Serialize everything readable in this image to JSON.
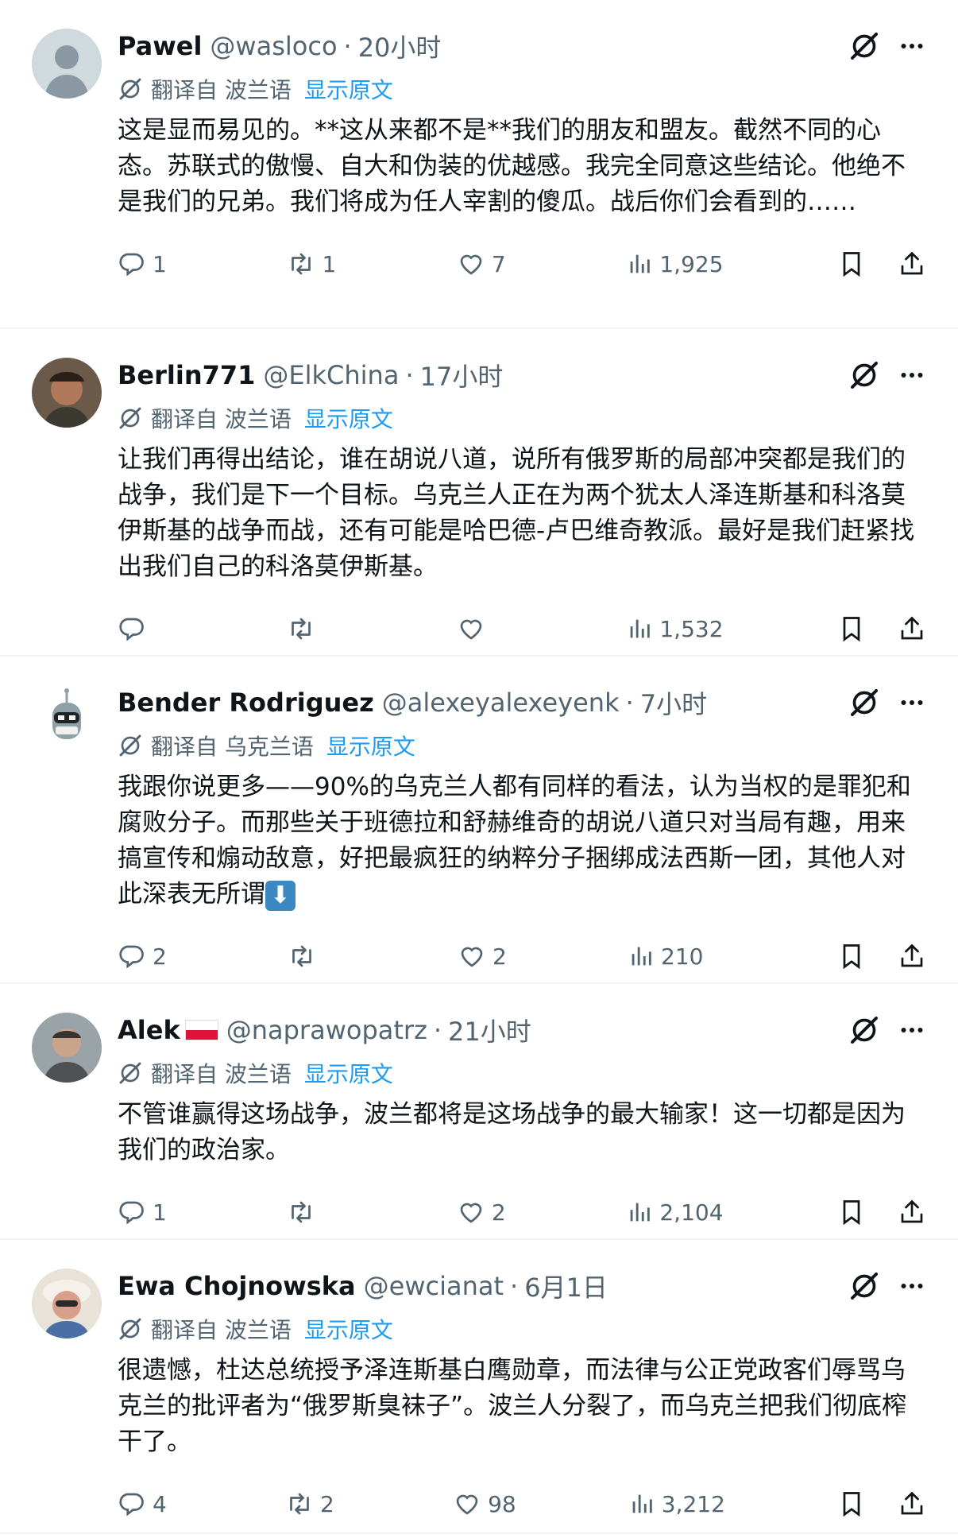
{
  "posts": [
    {
      "name": "Pawel",
      "handle": "@wasloco",
      "time": "20小时",
      "translate_label": "翻译自 波兰语",
      "show_original": "显示原文",
      "text": "这是显而易见的。**这从来都不是**我们的朋友和盟友。截然不同的心态。苏联式的傲慢、自大和伪装的优越感。我完全同意这些结论。他绝不是我们的兄弟。我们将成为任人宰割的傻瓜。战后你们会看到的……",
      "replies": "1",
      "reposts": "1",
      "likes": "7",
      "views": "1,925"
    },
    {
      "name": "Berlin771",
      "handle": "@ElkChina",
      "time": "17小时",
      "translate_label": "翻译自 波兰语",
      "show_original": "显示原文",
      "text": "让我们再得出结论，谁在胡说八道，说所有俄罗斯的局部冲突都是我们的战争，我们是下一个目标。乌克兰人正在为两个犹太人泽连斯基和科洛莫伊斯基的战争而战，还有可能是哈巴德-卢巴维奇教派。最好是我们赶紧找出我们自己的科洛莫伊斯基。",
      "replies": "",
      "reposts": "",
      "likes": "",
      "views": "1,532"
    },
    {
      "name": "Bender Rodriguez",
      "handle": "@alexeyalexeyenk",
      "time": "7小时",
      "translate_label": "翻译自 乌克兰语",
      "show_original": "显示原文",
      "text": "我跟你说更多——90%的乌克兰人都有同样的看法，认为当权的是罪犯和腐败分子。而那些关于班德拉和舒赫维奇的胡说八道只对当局有趣，用来搞宣传和煽动敌意，好把最疯狂的纳粹分子捆绑成法西斯一团，其他人对此深表无所谓",
      "emoji": "⬇",
      "replies": "2",
      "reposts": "",
      "likes": "2",
      "views": "210"
    },
    {
      "name": "Alek",
      "handle": "@naprawopatrz",
      "time": "21小时",
      "translate_label": "翻译自 波兰语",
      "show_original": "显示原文",
      "text": "不管谁赢得这场战争，波兰都将是这场战争的最大输家！这一切都是因为我们的政治家。",
      "replies": "1",
      "reposts": "",
      "likes": "2",
      "views": "2,104"
    },
    {
      "name": "Ewa Chojnowska",
      "handle": "@ewcianat",
      "time": "6月1日",
      "translate_label": "翻译自 波兰语",
      "show_original": "显示原文",
      "text": "很遗憾，杜达总统授予泽连斯基白鹰勋章，而法律与公正党政客们辱骂乌克兰的批评者为“俄罗斯臭袜子”。波兰人分裂了，而乌克兰把我们彻底榨干了。",
      "replies": "4",
      "reposts": "2",
      "likes": "98",
      "views": "3,212"
    }
  ],
  "colors": {
    "text": "#0f1419",
    "secondary": "#536471",
    "link": "#1d9bf0",
    "divider": "#eff3f4"
  },
  "icons": [
    "reply-icon",
    "repost-icon",
    "like-icon",
    "views-icon",
    "bookmark-icon",
    "share-icon",
    "translate-icon",
    "grok-icon",
    "more-icon"
  ]
}
